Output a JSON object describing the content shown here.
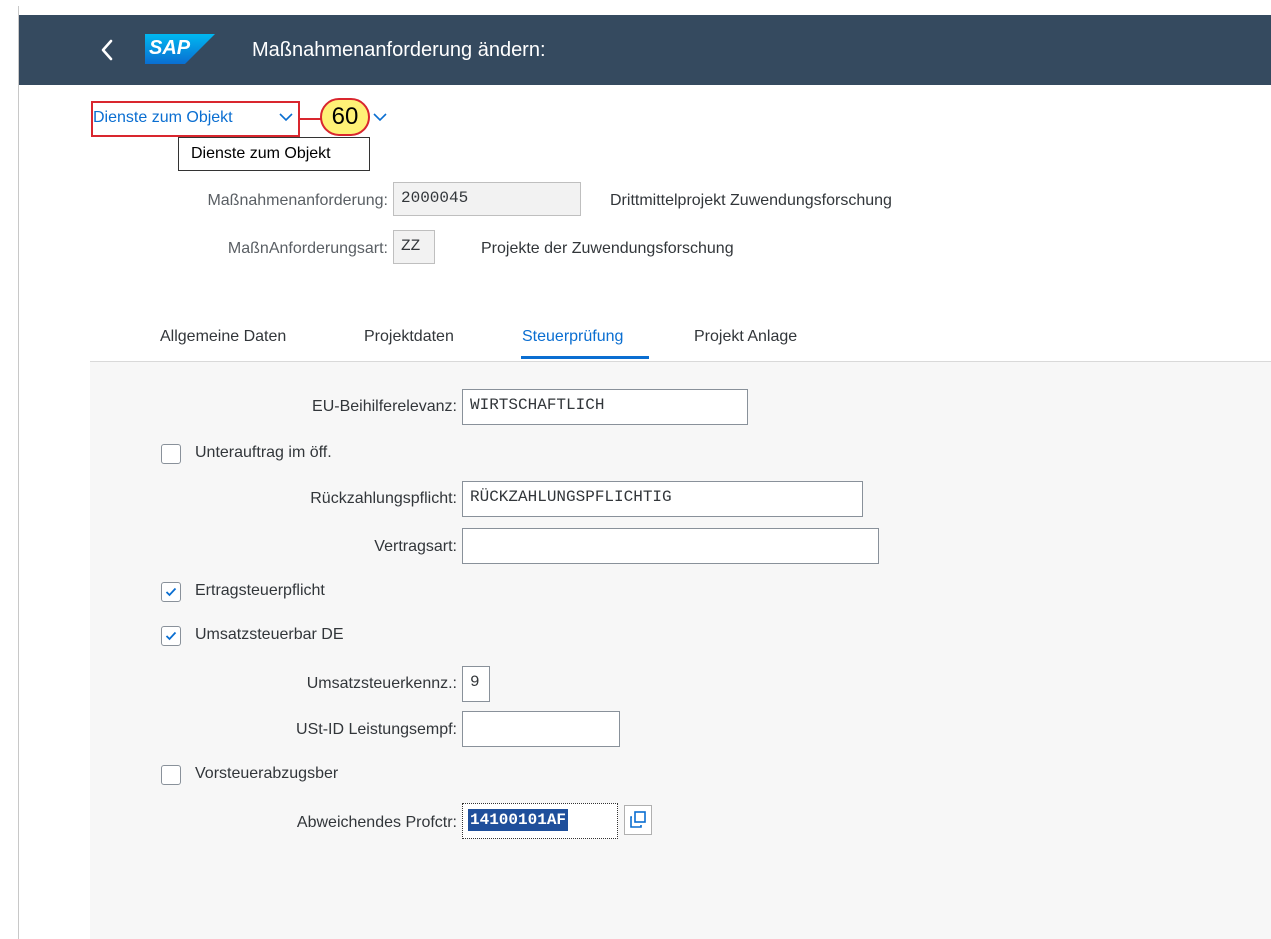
{
  "shell": {
    "title": "Maßnahmenanforderung ändern:",
    "logo_text": "SAP"
  },
  "toolbar": {
    "services_label": "Dienste zum Objekt",
    "callout_number": "60",
    "tooltip": "Dienste zum Objekt"
  },
  "header": {
    "request_label": "Maßnahmenanforderung:",
    "request_value": "2000045",
    "request_desc": "Drittmittelprojekt Zuwendungsforschung",
    "type_label": "MaßnAnforderungsart:",
    "type_value": "ZZ",
    "type_desc": "Projekte der Zuwendungsforschung"
  },
  "tabs": [
    {
      "label": "Allgemeine Daten",
      "active": false
    },
    {
      "label": "Projektdaten",
      "active": false
    },
    {
      "label": "Steuerprüfung",
      "active": true
    },
    {
      "label": "Projekt Anlage",
      "active": false
    }
  ],
  "form": {
    "eu_label": "EU-Beihilferelevanz:",
    "eu_value": "WIRTSCHAFTLICH",
    "subcontract_label": "Unterauftrag im öff.",
    "subcontract_checked": false,
    "repay_label": "Rückzahlungspflicht:",
    "repay_value": "RÜCKZAHLUNGSPFLICHTIG",
    "contract_label": "Vertragsart:",
    "contract_value": "",
    "incometax_label": "Ertragsteuerpflicht",
    "incometax_checked": true,
    "vat_label": "Umsatzsteuerbar DE",
    "vat_checked": true,
    "vatcode_label": "Umsatzsteuerkennz.:",
    "vatcode_value": "9",
    "vatid_label": "USt-ID Leistungsempf:",
    "vatid_value": "",
    "inputtax_label": "Vorsteuerabzugsber",
    "inputtax_checked": false,
    "profctr_label": "Abweichendes Profctr:",
    "profctr_value": "14100101AF"
  },
  "colors": {
    "shell_bg": "#354a5f",
    "accent": "#0a6ed1",
    "highlight_border": "#d9262e",
    "callout_fill": "#fff176"
  }
}
